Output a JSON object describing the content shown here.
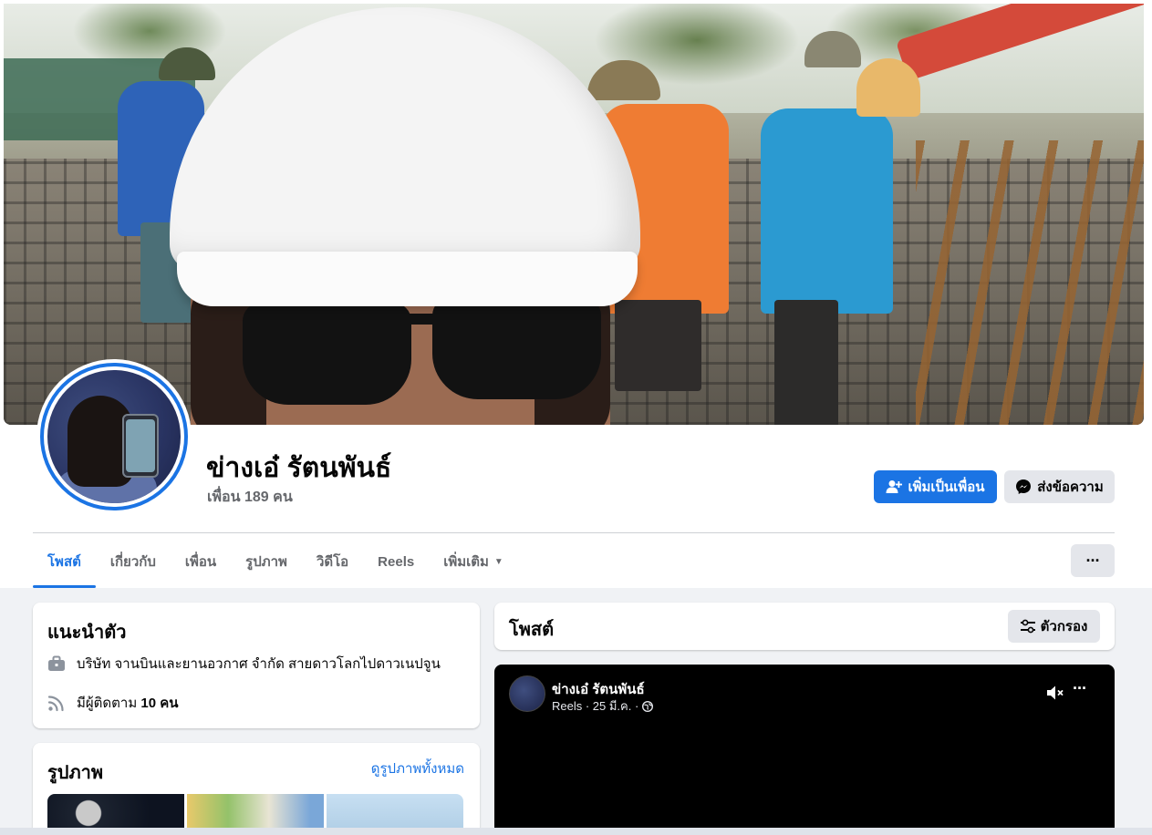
{
  "profile": {
    "name": "ข่างเอ๋ รัตนพันธ์",
    "friends": "เพื่อน 189 คน"
  },
  "actions": {
    "add_friend": "เพิ่มเป็นเพื่อน",
    "message": "ส่งข้อความ",
    "more": "···"
  },
  "tabs": [
    {
      "label": "โพสต์",
      "active": true
    },
    {
      "label": "เกี่ยวกับ",
      "active": false
    },
    {
      "label": "เพื่อน",
      "active": false
    },
    {
      "label": "รูปภาพ",
      "active": false
    },
    {
      "label": "วิดีโอ",
      "active": false
    },
    {
      "label": "Reels",
      "active": false
    },
    {
      "label": "เพิ่มเติม",
      "active": false
    }
  ],
  "intro": {
    "title": "แนะนำตัว",
    "work": "บริษัท จานบินและยานอวกาศ จำกัด สายดาวโลกไปดาวเนปจูน",
    "followers_prefix": "มีผู้ติดตาม ",
    "followers_count": "10 คน"
  },
  "photos": {
    "title": "รูปภาพ",
    "see_all": "ดูรูปภาพทั้งหมด"
  },
  "posts": {
    "title": "โพสต์",
    "filter": "ตัวกรอง"
  },
  "reel_post": {
    "author": "ข่างเอ๋ รัตนพันธ์",
    "meta": "Reels · 25 มี.ค. ·",
    "more": "···"
  },
  "colors": {
    "accent": "#1b74e4",
    "secondary_button": "#e4e6eb",
    "background": "#f0f2f5"
  }
}
